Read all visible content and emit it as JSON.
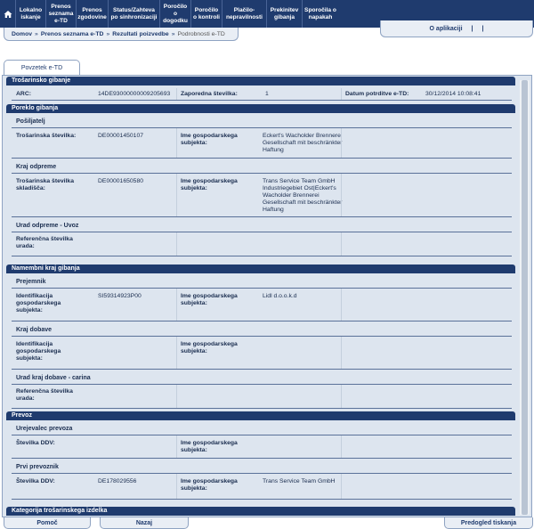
{
  "nav": {
    "items": [
      {
        "label": "Lokalno iskanje",
        "width": 34
      },
      {
        "label": "Prenos seznama e-TD",
        "width": 34
      },
      {
        "label": "Prenos zgodovine",
        "width": 36
      },
      {
        "label": "Status/Zahteva po sinhronizaciji",
        "width": 58
      },
      {
        "label": "Poročilo o dogodku",
        "width": 35
      },
      {
        "label": "Poročilo o kontroli",
        "width": 35
      },
      {
        "label": "Plačilo-nepravilnosti",
        "width": 50
      },
      {
        "label": "Prekinitev gibanja",
        "width": 40
      },
      {
        "label": "Sporočila o napakah",
        "width": 40
      }
    ]
  },
  "about": {
    "label": "O aplikaciji",
    "sep1": "|",
    "sep2": "|"
  },
  "breadcrumb": {
    "home": "Domov",
    "list": "Prenos seznama e-TD",
    "results": "Rezultati poizvedbe",
    "current": "Podrobnosti e-TD",
    "sep": "»"
  },
  "tab": {
    "label": "Povzetek e-TD"
  },
  "sections": {
    "movement": "Trošarinsko gibanje",
    "origin": "Poreklo gibanja",
    "destination": "Namembni kraj gibanja",
    "transport": "Prevoz",
    "category": "Kategorija trošarinskega izdelka"
  },
  "movement": {
    "arc_label": "ARC:",
    "arc_value": "14DE93000000009205693",
    "seq_label": "Zaporedna številka:",
    "seq_value": "1",
    "date_label": "Datum potrditve e-TD:",
    "date_value": "30/12/2014 10:08:41"
  },
  "origin": {
    "consignor_sub": "Pošiljatelj",
    "consignor_excise_label": "Trošarinska številka:",
    "consignor_excise_value": "DE00001450107",
    "consignor_name_label": "Ime gospodarskega subjekta:",
    "consignor_name_value": "Eckert's Wacholder Brennerei Gesellschaft mit beschränkter Haftung",
    "dispatch_sub": "Kraj odpreme",
    "dispatch_excise_label": "Trošarinska številka skladišča:",
    "dispatch_excise_value": "DE00001650580",
    "dispatch_name_label": "Ime gospodarskega subjekta:",
    "dispatch_name_value": "Trans Service Team GmbH Industriegebiet Ost|Eckert's Wacholder Brennerei Gesellschaft mit beschränkter Haftung",
    "office_sub": "Urad odpreme - Uvoz",
    "office_ref_label": "Referenčna številka urada:"
  },
  "destination": {
    "consignee_sub": "Prejemnik",
    "consignee_id_label": "Identifikacija gospodarskega subjekta:",
    "consignee_id_value": "SI59314923P00",
    "consignee_name_label": "Ime gospodarskega subjekta:",
    "consignee_name_value": "Lidl d.o.o.k.d",
    "delivery_sub": "Kraj dobave",
    "delivery_id_label": "Identifikacija gospodarskega subjekta:",
    "delivery_name_label": "Ime gospodarskega subjekta:",
    "office_sub": "Urad kraj dobave - carina",
    "office_ref_label": "Referenčna številka urada:"
  },
  "transport": {
    "arranger_sub": "Urejevalec prevoza",
    "arranger_vat_label": "Številka DDV:",
    "arranger_name_label": "Ime gospodarskega subjekta:",
    "first_sub": "Prvi prevoznik",
    "first_vat_label": "Številka DDV:",
    "first_vat_value": "DE178029556",
    "first_name_label": "Ime gospodarskega subjekta:",
    "first_name_value": "Trans Service Team GmbH"
  },
  "footer": {
    "help": "Pomoč",
    "back": "Nazaj",
    "print": "Predogled tiskanja"
  },
  "colors": {
    "header": "#1f3b6e",
    "panel": "#dde5ef",
    "border": "#8fa3c2"
  }
}
